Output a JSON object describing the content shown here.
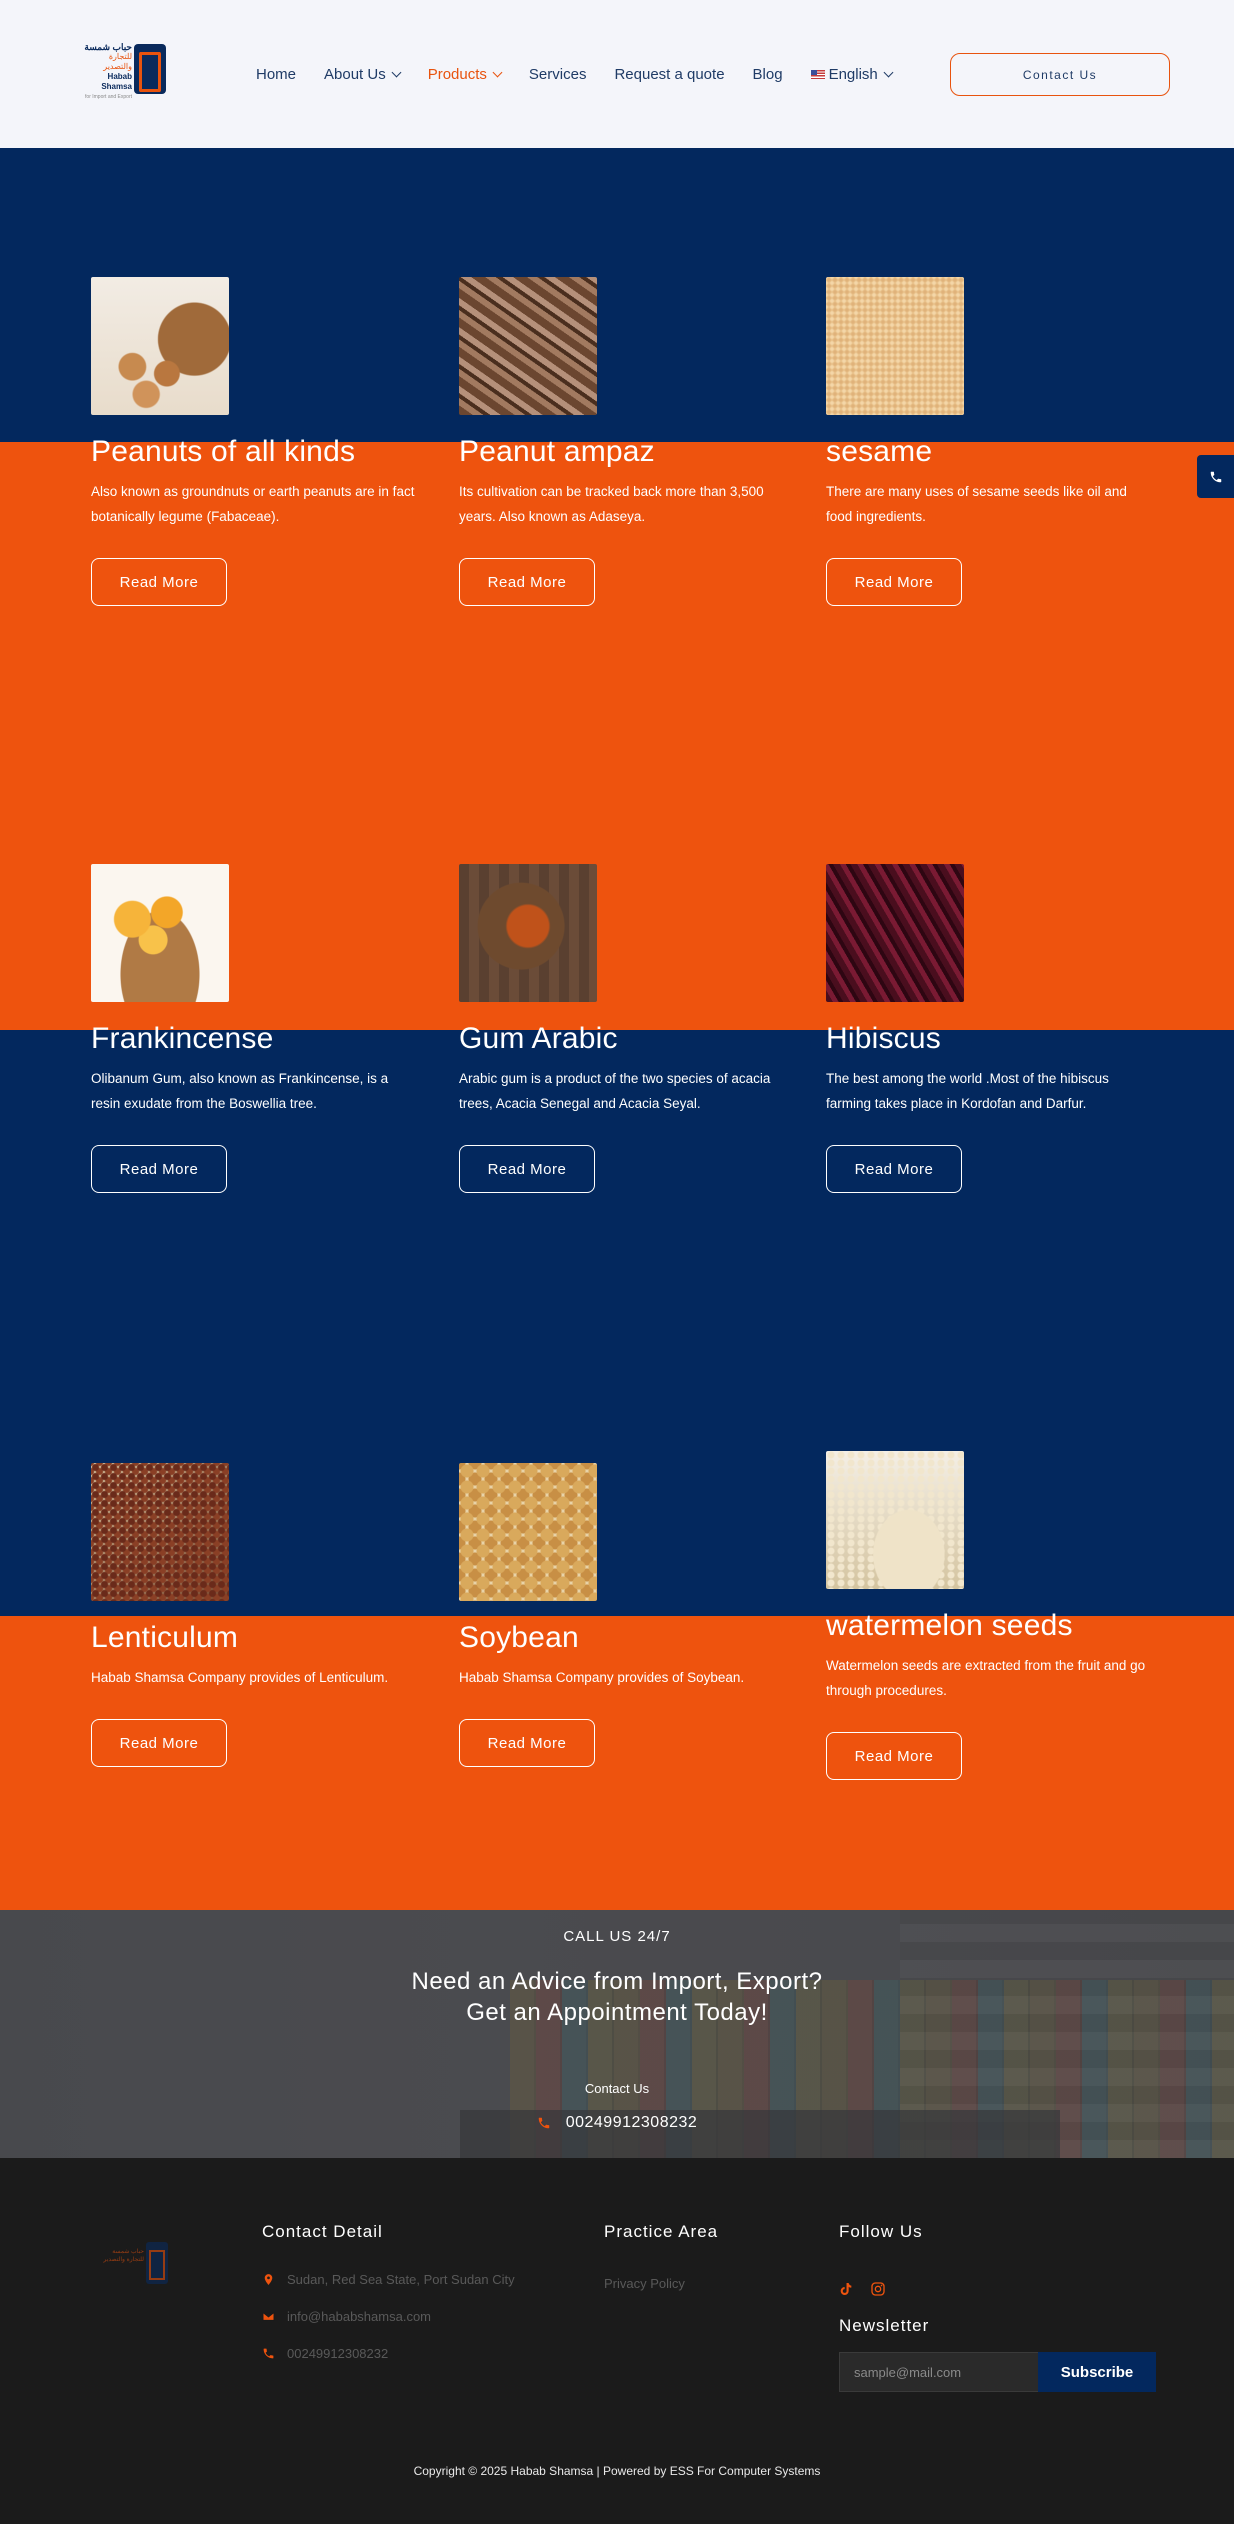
{
  "header": {
    "logo": {
      "line1": "حباب شمسة",
      "line2": "للتجارة والتصدير",
      "line3": "Habab Shamsa",
      "line4": "for Import and Export"
    },
    "nav": [
      {
        "label": "Home",
        "dropdown": false,
        "active": false
      },
      {
        "label": "About Us",
        "dropdown": true,
        "active": false
      },
      {
        "label": "Products",
        "dropdown": true,
        "active": true
      },
      {
        "label": "Services",
        "dropdown": false,
        "active": false
      },
      {
        "label": "Request a quote",
        "dropdown": false,
        "active": false
      },
      {
        "label": "Blog",
        "dropdown": false,
        "active": false
      },
      {
        "label": "English",
        "dropdown": true,
        "active": false,
        "icon": "us-flag-icon"
      }
    ],
    "contact_button": "Contact Us"
  },
  "colors": {
    "navy": "#03285e",
    "orange": "#ee530e",
    "nav_text": "#1f3b66",
    "footer_bg": "#1b1b1b"
  },
  "products": [
    {
      "title": "Peanuts of all kinds",
      "desc": "Also known as groundnuts or earth peanuts are in fact botanically legume (Fabaceae).",
      "button": "Read More"
    },
    {
      "title": "Peanut ampaz",
      "desc": "Its cultivation can be tracked back more than 3,500 years. Also known as  Adaseya.",
      "button": "Read More"
    },
    {
      "title": "sesame",
      "desc": "There are many uses of sesame seeds like oil and food ingredients.",
      "button": "Read More"
    },
    {
      "title": "Frankincense",
      "desc": "Olibanum Gum, also known as Frankincense, is a resin exudate from the Boswellia tree.",
      "button": "Read More"
    },
    {
      "title": "Gum Arabic",
      "desc": " Arabic gum is a product of the two species of acacia trees, Acacia Senegal and Acacia Seyal.",
      "button": "Read More"
    },
    {
      "title": "Hibiscus",
      "desc": "The best among the world .Most of the hibiscus farming takes place in Kordofan and Darfur.",
      "button": "Read More"
    },
    {
      "title": "Lenticulum",
      "desc": "Habab Shamsa Company provides of Lenticulum.",
      "button": "Read More"
    },
    {
      "title": "Soybean",
      "desc": "Habab Shamsa Company provides of Soybean.",
      "button": "Read More"
    },
    {
      "title": "watermelon seeds",
      "desc": "Watermelon seeds are extracted from the fruit and go through procedures.",
      "button": "Read More"
    }
  ],
  "cta": {
    "call": "CALL US 24/7",
    "heading_line1": "Need an Advice from Import, Export?",
    "heading_line2": "Get an Appointment Today!",
    "contact_label": "Contact Us",
    "phone": "00249912308232"
  },
  "footer": {
    "logo_line1": "حباب شمسة",
    "logo_line2": "للتجارة والتصدير",
    "contact_title": "Contact Detail",
    "address": "Sudan, Red Sea State, Port Sudan City",
    "email": "info@hababshamsa.com",
    "phone": "00249912308232",
    "practice_title": "Practice Area",
    "privacy": "Privacy Policy",
    "follow_title": "Follow Us",
    "newsletter_title": "Newsletter",
    "newsletter_placeholder": "sample@mail.com",
    "subscribe": "Subscribe",
    "copyright": "Copyright © 2025 Habab Shamsa | Powered by ESS For Computer Systems"
  }
}
